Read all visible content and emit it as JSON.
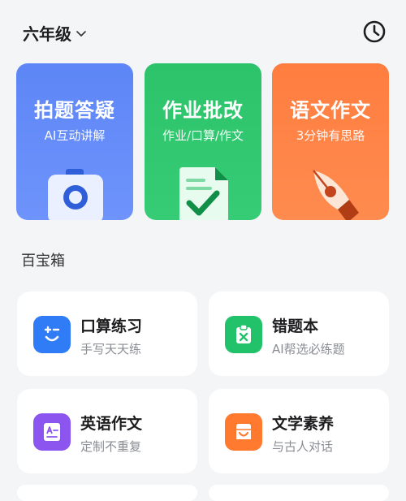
{
  "header": {
    "grade": "六年级",
    "history_icon": "clock-icon"
  },
  "features": [
    {
      "title": "拍题答疑",
      "subtitle": "AI互动讲解",
      "color": "#5d86f6",
      "icon": "camera-icon"
    },
    {
      "title": "作业批改",
      "subtitle": "作业/口算/作文",
      "color": "#2cc36a",
      "icon": "document-check-icon"
    },
    {
      "title": "语文作文",
      "subtitle": "3分钟有思路",
      "color": "#ff7d3f",
      "icon": "pen-nib-icon"
    }
  ],
  "toolbox": {
    "title": "百宝箱",
    "items": [
      {
        "title": "口算练习",
        "subtitle": "手写天天练",
        "color": "#2f7cf6",
        "icon": "calc-face-icon"
      },
      {
        "title": "错题本",
        "subtitle": "AI帮选必练题",
        "color": "#22c26a",
        "icon": "clipboard-x-icon"
      },
      {
        "title": "英语作文",
        "subtitle": "定制不重复",
        "color": "#8c55f0",
        "icon": "english-doc-icon"
      },
      {
        "title": "文学素养",
        "subtitle": "与古人对话",
        "color": "#ff7a2f",
        "icon": "scroll-icon"
      }
    ]
  }
}
